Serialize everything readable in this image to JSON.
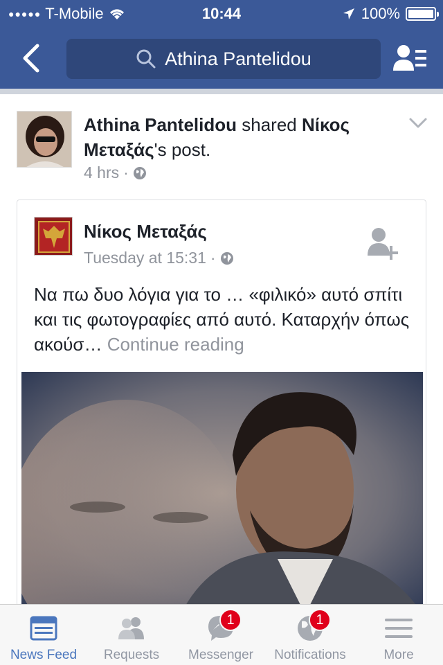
{
  "status_bar": {
    "carrier": "T-Mobile",
    "time": "10:44",
    "battery": "100%"
  },
  "nav": {
    "search_value": "Athina Pantelidou"
  },
  "story": {
    "author": "Athina Pantelidou",
    "action": "shared",
    "shared_from": "Νίκος Μεταξάς",
    "suffix": "'s post.",
    "time": "4 hrs",
    "separator": "·"
  },
  "shared_post": {
    "author": "Νίκος Μεταξάς",
    "time": "Tuesday at 15:31",
    "separator": "·",
    "text": "Να πω δυο λόγια για το … «φιλικό» αυτό σπίτι και τις φωτογραφίες από αυτό. Καταρχήν όπως ακούσ…",
    "continue_label": "Continue reading"
  },
  "tabs": [
    {
      "label": "News Feed",
      "icon": "news-feed-icon",
      "active": true
    },
    {
      "label": "Requests",
      "icon": "friend-requests-icon"
    },
    {
      "label": "Messenger",
      "icon": "messenger-icon",
      "badge": "1"
    },
    {
      "label": "Notifications",
      "icon": "globe-icon",
      "badge": "1"
    },
    {
      "label": "More",
      "icon": "menu-icon"
    }
  ],
  "colors": {
    "brand": "#3b5998",
    "active_tab": "#4a76bd",
    "badge": "#e0001b",
    "muted": "#90949c"
  }
}
